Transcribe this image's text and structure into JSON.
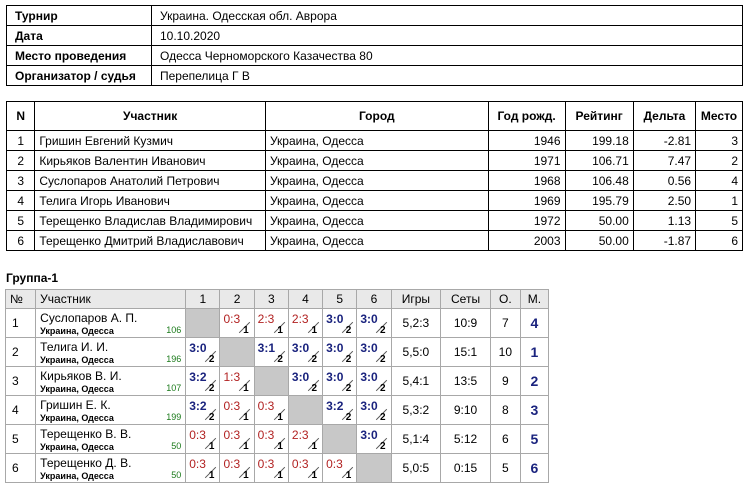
{
  "info": [
    {
      "label": "Турнир",
      "value": "Украина. Одесская обл. Аврора"
    },
    {
      "label": "Дата",
      "value": "10.10.2020"
    },
    {
      "label": "Место проведения",
      "value": "Одесса  Черноморского Казачества 80"
    },
    {
      "label": "Организатор / судья",
      "value": "Перепелица Г В"
    }
  ],
  "participants": {
    "headers": [
      "N",
      "Участник",
      "Город",
      "Год рожд.",
      "Рейтинг",
      "Дельта",
      "Место"
    ],
    "rows": [
      [
        "1",
        "Гришин Евгений Кузмич",
        "Украина, Одесса",
        "1946",
        "199.18",
        "-2.81",
        "3"
      ],
      [
        "2",
        "Кирьяков Валентин Иванович",
        "Украина, Одесса",
        "1971",
        "106.71",
        "7.47",
        "2"
      ],
      [
        "3",
        "Суслопаров  Анатолий Петрович",
        "Украина, Одесса",
        "1968",
        "106.48",
        "0.56",
        "4"
      ],
      [
        "4",
        "Телига Игорь Иванович",
        "Украина, Одесса",
        "1969",
        "195.79",
        "2.50",
        "1"
      ],
      [
        "5",
        "Терещенко Владислав Владимирович",
        "Украина, Одесса",
        "1972",
        "50.00",
        "1.13",
        "5"
      ],
      [
        "6",
        "Терещенко Дмитрий Владиславович",
        "Украина, Одесса",
        "2003",
        "50.00",
        "-1.87",
        "6"
      ]
    ]
  },
  "group": {
    "title": "Группа-1",
    "headers": [
      "№",
      "Участник",
      "1",
      "2",
      "3",
      "4",
      "5",
      "6",
      "Игры",
      "Сеты",
      "О.",
      "М."
    ],
    "rows": [
      {
        "n": "1",
        "name": "Суслопаров А. П.",
        "city": "Украина, Одесса",
        "rating": "106",
        "cells": [
          null,
          {
            "s": "0:3",
            "w": false,
            "r": "1"
          },
          {
            "s": "2:3",
            "w": false,
            "r": "1"
          },
          {
            "s": "2:3",
            "w": false,
            "r": "1"
          },
          {
            "s": "3:0",
            "w": true,
            "r": "2"
          },
          {
            "s": "3:0",
            "w": true,
            "r": "2"
          }
        ],
        "games": "5,2:3",
        "sets": "10:9",
        "points": "7",
        "place": "4"
      },
      {
        "n": "2",
        "name": "Телига И. И.",
        "city": "Украина, Одесса",
        "rating": "196",
        "cells": [
          {
            "s": "3:0",
            "w": true,
            "r": "2"
          },
          null,
          {
            "s": "3:1",
            "w": true,
            "r": "2"
          },
          {
            "s": "3:0",
            "w": true,
            "r": "2"
          },
          {
            "s": "3:0",
            "w": true,
            "r": "2"
          },
          {
            "s": "3:0",
            "w": true,
            "r": "2"
          }
        ],
        "games": "5,5:0",
        "sets": "15:1",
        "points": "10",
        "place": "1"
      },
      {
        "n": "3",
        "name": "Кирьяков В. И.",
        "city": "Украина, Одесса",
        "rating": "107",
        "cells": [
          {
            "s": "3:2",
            "w": true,
            "r": "2"
          },
          {
            "s": "1:3",
            "w": false,
            "r": "1"
          },
          null,
          {
            "s": "3:0",
            "w": true,
            "r": "2"
          },
          {
            "s": "3:0",
            "w": true,
            "r": "2"
          },
          {
            "s": "3:0",
            "w": true,
            "r": "2"
          }
        ],
        "games": "5,4:1",
        "sets": "13:5",
        "points": "9",
        "place": "2"
      },
      {
        "n": "4",
        "name": "Гришин Е. К.",
        "city": "Украина, Одесса",
        "rating": "199",
        "cells": [
          {
            "s": "3:2",
            "w": true,
            "r": "2"
          },
          {
            "s": "0:3",
            "w": false,
            "r": "1"
          },
          {
            "s": "0:3",
            "w": false,
            "r": "1"
          },
          null,
          {
            "s": "3:2",
            "w": true,
            "r": "2"
          },
          {
            "s": "3:0",
            "w": true,
            "r": "2"
          }
        ],
        "games": "5,3:2",
        "sets": "9:10",
        "points": "8",
        "place": "3"
      },
      {
        "n": "5",
        "name": "Терещенко В. В.",
        "city": "Украина, Одесса",
        "rating": "50",
        "cells": [
          {
            "s": "0:3",
            "w": false,
            "r": "1"
          },
          {
            "s": "0:3",
            "w": false,
            "r": "1"
          },
          {
            "s": "0:3",
            "w": false,
            "r": "1"
          },
          {
            "s": "2:3",
            "w": false,
            "r": "1"
          },
          null,
          {
            "s": "3:0",
            "w": true,
            "r": "2"
          }
        ],
        "games": "5,1:4",
        "sets": "5:12",
        "points": "6",
        "place": "5"
      },
      {
        "n": "6",
        "name": "Терещенко Д. В.",
        "city": "Украина, Одесса",
        "rating": "50",
        "cells": [
          {
            "s": "0:3",
            "w": false,
            "r": "1"
          },
          {
            "s": "0:3",
            "w": false,
            "r": "1"
          },
          {
            "s": "0:3",
            "w": false,
            "r": "1"
          },
          {
            "s": "0:3",
            "w": false,
            "r": "1"
          },
          {
            "s": "0:3",
            "w": false,
            "r": "1"
          },
          null
        ],
        "games": "5,0:5",
        "sets": "0:15",
        "points": "5",
        "place": "6"
      }
    ]
  },
  "colors": {
    "win": "#1a237e",
    "loss": "#b22222",
    "rating": "#1a7a1a",
    "diagonal": "#c8c8c8",
    "header_bg": "#e9e9e9"
  }
}
